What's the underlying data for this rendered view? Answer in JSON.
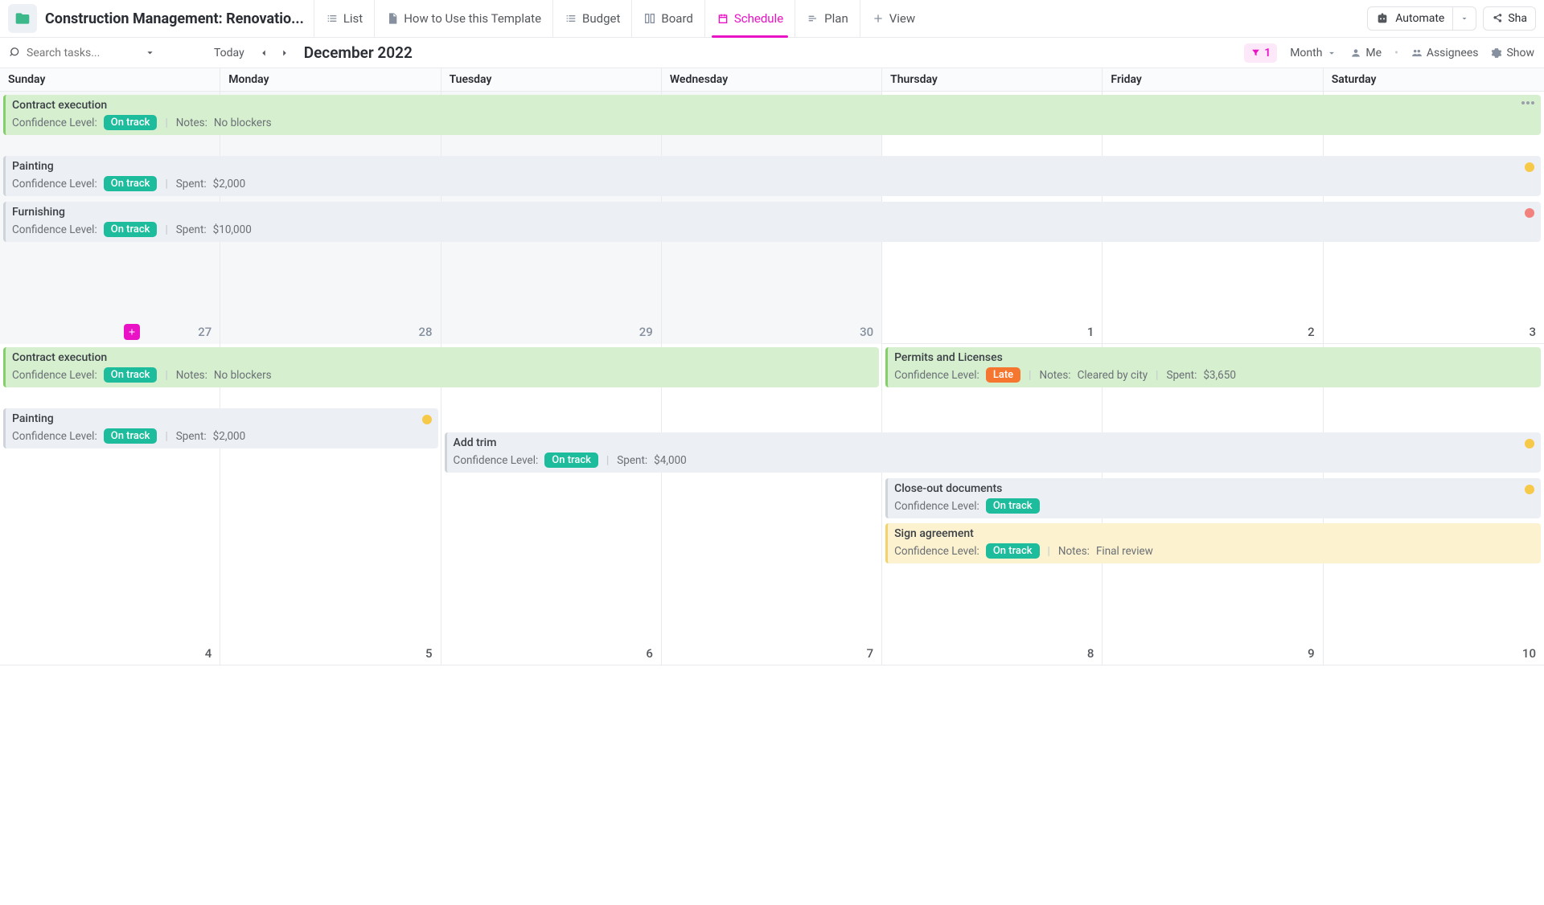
{
  "header": {
    "page_title": "Construction Management: Renovatio...",
    "tabs": {
      "list": "List",
      "howto": "How to Use this Template",
      "budget": "Budget",
      "board": "Board",
      "schedule": "Schedule",
      "plan": "Plan",
      "view": "View"
    },
    "automate": "Automate",
    "share": "Sha"
  },
  "toolbar": {
    "search_placeholder": "Search tasks...",
    "today": "Today",
    "month_label": "December 2022",
    "filter_count": "1",
    "month": "Month",
    "me": "Me",
    "assignees": "Assignees",
    "show": "Show"
  },
  "day_headers": [
    "Sunday",
    "Monday",
    "Tuesday",
    "Wednesday",
    "Thursday",
    "Friday",
    "Saturday"
  ],
  "week1": {
    "days": [
      "27",
      "28",
      "29",
      "30",
      "1",
      "2",
      "3"
    ]
  },
  "week2": {
    "days": [
      "4",
      "5",
      "6",
      "7",
      "8",
      "9",
      "10"
    ]
  },
  "events": {
    "contract1": {
      "title": "Contract execution",
      "confidence_label": "Confidence Level:",
      "badge": "On track",
      "notes_label": "Notes:",
      "notes": "No blockers"
    },
    "painting1": {
      "title": "Painting",
      "confidence_label": "Confidence Level:",
      "badge": "On track",
      "spent_label": "Spent:",
      "spent": "$2,000"
    },
    "furnishing": {
      "title": "Furnishing",
      "confidence_label": "Confidence Level:",
      "badge": "On track",
      "spent_label": "Spent:",
      "spent": "$10,000"
    },
    "contract2": {
      "title": "Contract execution",
      "confidence_label": "Confidence Level:",
      "badge": "On track",
      "notes_label": "Notes:",
      "notes": "No blockers"
    },
    "permits": {
      "title": "Permits and Licenses",
      "confidence_label": "Confidence Level:",
      "badge": "Late",
      "notes_label": "Notes:",
      "notes": "Cleared by city",
      "spent_label": "Spent:",
      "spent": "$3,650"
    },
    "painting2": {
      "title": "Painting",
      "confidence_label": "Confidence Level:",
      "badge": "On track",
      "spent_label": "Spent:",
      "spent": "$2,000"
    },
    "addtrim": {
      "title": "Add trim",
      "confidence_label": "Confidence Level:",
      "badge": "On track",
      "spent_label": "Spent:",
      "spent": "$4,000"
    },
    "closeout": {
      "title": "Close-out documents",
      "confidence_label": "Confidence Level:",
      "badge": "On track"
    },
    "sign": {
      "title": "Sign agreement",
      "confidence_label": "Confidence Level:",
      "badge": "On track",
      "notes_label": "Notes:",
      "notes": "Final review"
    }
  }
}
